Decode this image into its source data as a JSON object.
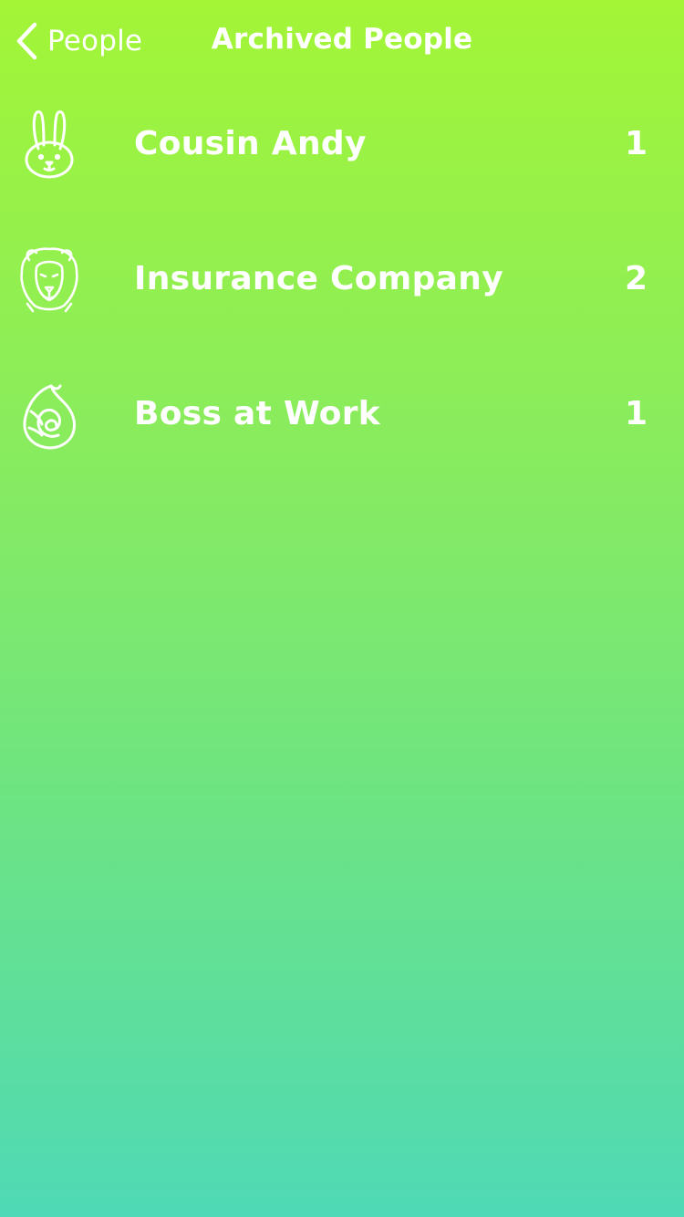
{
  "nav": {
    "back_label": "People",
    "title": "Archived People"
  },
  "people": [
    {
      "name": "Cousin Andy",
      "count": "1",
      "icon": "rabbit-icon"
    },
    {
      "name": "Insurance Company",
      "count": "2",
      "icon": "lion-icon"
    },
    {
      "name": "Boss at Work",
      "count": "1",
      "icon": "shell-icon"
    }
  ],
  "colors": {
    "gradient_top": "#a3f536",
    "gradient_bottom": "#4fd9b6",
    "text": "#ffffff"
  }
}
